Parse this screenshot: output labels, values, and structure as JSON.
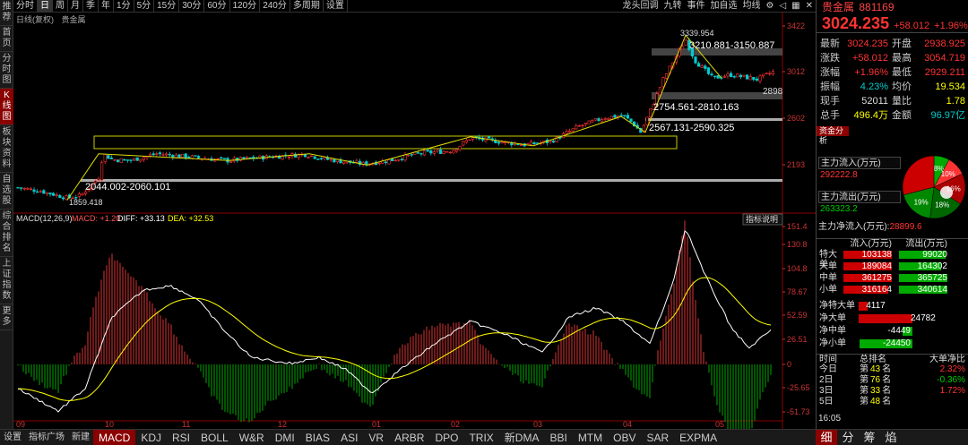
{
  "left_tabs": [
    "推荐",
    "首页",
    "分时图",
    "K线图",
    "板块资料",
    "自选股",
    "综合排名",
    "上证指数",
    "更多"
  ],
  "active_left_tab": 3,
  "toolbar": {
    "items": [
      "分时",
      "日",
      "周",
      "月",
      "季",
      "年",
      "1分",
      "5分",
      "15分",
      "30分",
      "60分",
      "120分",
      "240分",
      "多周期",
      "设置"
    ],
    "active_index": 1,
    "right_items": [
      "龙头回调",
      "九转",
      "事件",
      "加自选",
      "均线"
    ],
    "icons": [
      "settings-icon",
      "back-icon",
      "grid-icon",
      "close-icon"
    ]
  },
  "chart_sub": {
    "mode": "日线(复权)",
    "name": "贵金属"
  },
  "price_axis": [
    "3422",
    "3012",
    "2602",
    "2193"
  ],
  "kline_annotations": {
    "high_label": "3339.954",
    "low_label": "1859.418",
    "right_edge_label": "2898",
    "support_zones": [
      "3210.881-3150.887",
      "2754.561-2810.163",
      "2567.131-2590.325",
      "2044.002-2060.101"
    ]
  },
  "macd_header": {
    "name": "MACD(12,26,9)",
    "macd_label": "MACD: +1.20",
    "diff_label": "DIFF: +33.13",
    "dea_label": "DEA: +32.53",
    "indicator_btn": "指标说明"
  },
  "macd_axis": [
    "151.4",
    "130.8",
    "104.8",
    "78.67",
    "52.59",
    "26.51",
    "0",
    "-25.65",
    "-51.73"
  ],
  "date_axis": [
    "09",
    "10",
    "11",
    "12",
    "01",
    "02",
    "03",
    "04",
    "05"
  ],
  "bottom_tabs": {
    "small": [
      "设置",
      "指标广场",
      "新建"
    ],
    "items": [
      "MACD",
      "KDJ",
      "RSI",
      "BOLL",
      "W&R",
      "DMI",
      "BIAS",
      "ASI",
      "VR",
      "ARBR",
      "DPO",
      "TRIX",
      "新DMA",
      "BBI",
      "MTM",
      "OBV",
      "SAR",
      "EXPMA"
    ],
    "active_index": 0
  },
  "quote": {
    "title": "贵金属",
    "code": "881169",
    "price": "3024.235",
    "change": "+58.012",
    "change_pct": "+1.96%",
    "rows": [
      {
        "l1": "最新",
        "v1": "3024.235",
        "c1": "red",
        "l2": "开盘",
        "v2": "2938.925",
        "c2": "red"
      },
      {
        "l1": "涨跌",
        "v1": "+58.012",
        "c1": "red",
        "l2": "最高",
        "v2": "3054.719",
        "c2": "red"
      },
      {
        "l1": "涨幅",
        "v1": "+1.96%",
        "c1": "red",
        "l2": "最低",
        "v2": "2929.211",
        "c2": "red"
      },
      {
        "l1": "振幅",
        "v1": "4.23%",
        "c1": "cyan",
        "l2": "均价",
        "v2": "19.534",
        "c2": "yellow"
      },
      {
        "l1": "现手",
        "v1": "52011",
        "c1": "white",
        "l2": "量比",
        "v2": "1.78",
        "c2": "yellow"
      },
      {
        "l1": "总手",
        "v1": "496.4万",
        "c1": "yellow",
        "l2": "金额",
        "v2": "96.97亿",
        "c2": "cyan"
      }
    ]
  },
  "fund": {
    "section": "资金分析",
    "inflow_label": "主力流入(万元)",
    "inflow_value": "292222.8",
    "outflow_label": "主力流出(万元)",
    "outflow_value": "263323.2",
    "net_label": "主力净流入(万元):",
    "net_value": "28899.6",
    "pie": [
      {
        "label": "8%",
        "value": 8,
        "color": "#00aa00"
      },
      {
        "label": "10%",
        "value": 10,
        "color": "#ff3333"
      },
      {
        "label": "16%",
        "value": 16,
        "color": "#aa0000"
      },
      {
        "label": "18%",
        "value": 18,
        "color": "#006600"
      },
      {
        "label": "19%",
        "value": 19,
        "color": "#008800"
      },
      {
        "label": "",
        "value": 29,
        "color": "#cc0000"
      }
    ]
  },
  "orders": {
    "hdr_in": "流入(万元)",
    "hdr_out": "流出(万元)",
    "rows": [
      {
        "label": "特大单",
        "in": "103138",
        "in_pct": 1.0,
        "out": "99020",
        "out_pct": 0.96
      },
      {
        "label": "大单",
        "in": "189084",
        "in_pct": 1.0,
        "out": "164302",
        "out_pct": 0.87
      },
      {
        "label": "中单",
        "in": "361275",
        "in_pct": 1.0,
        "out": "365725",
        "out_pct": 1.0
      },
      {
        "label": "小单",
        "in": "316164",
        "in_pct": 0.93,
        "out": "340614",
        "out_pct": 1.0
      }
    ]
  },
  "net": {
    "rows": [
      {
        "label": "净特大单",
        "value": "4117",
        "sign": 1,
        "pct": 0.17
      },
      {
        "label": "净大单",
        "value": "24782",
        "sign": 1,
        "pct": 1.0
      },
      {
        "label": "净中单",
        "value": "-4449",
        "sign": -1,
        "pct": 0.18
      },
      {
        "label": "净小单",
        "value": "-24450",
        "sign": -1,
        "pct": 0.99
      }
    ]
  },
  "rank": {
    "hdr": [
      "时间",
      "总排名",
      "大单净比"
    ],
    "rows": [
      {
        "t": "今日",
        "r": "第",
        "n": "43",
        "u": "名",
        "p": "2.32%",
        "c": "red"
      },
      {
        "t": "2日",
        "r": "第",
        "n": "76",
        "u": "名",
        "p": "-0.36%",
        "c": "green"
      },
      {
        "t": "3日",
        "r": "第",
        "n": "33",
        "u": "名",
        "p": "1.72%",
        "c": "red"
      },
      {
        "t": "5日",
        "r": "第",
        "n": "48",
        "u": "名",
        "p": "",
        "c": "red"
      }
    ],
    "time": "16:05"
  },
  "bottom_right": [
    "细",
    "分",
    "筹",
    "焰"
  ]
}
